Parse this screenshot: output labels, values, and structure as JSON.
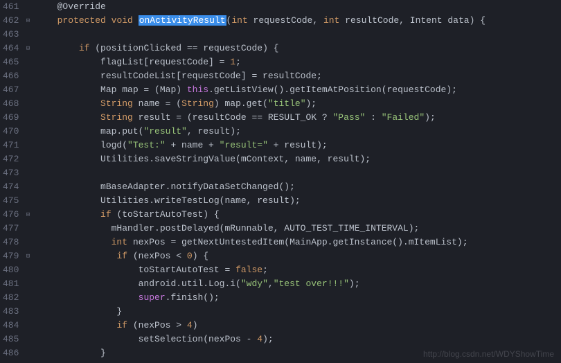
{
  "gutter": {
    "start": 461,
    "end": 486
  },
  "fold_markers": {
    "462": "⊟",
    "464": "⊟",
    "476": "⊟",
    "479": "⊟"
  },
  "code": {
    "l461": {
      "indent": "    ",
      "t": [
        {
          "c": "ann",
          "v": "@Override"
        }
      ]
    },
    "l462": {
      "indent": "    ",
      "t": [
        {
          "c": "kw",
          "v": "protected"
        },
        {
          "c": "",
          "v": " "
        },
        {
          "c": "kw",
          "v": "void"
        },
        {
          "c": "",
          "v": " "
        },
        {
          "c": "hl",
          "v": "onActivityResult"
        },
        {
          "c": "",
          "v": "("
        },
        {
          "c": "kw",
          "v": "int"
        },
        {
          "c": "",
          "v": " requestCode, "
        },
        {
          "c": "kw",
          "v": "int"
        },
        {
          "c": "",
          "v": " resultCode, Intent data) {"
        }
      ]
    },
    "l463": {
      "indent": "",
      "t": []
    },
    "l464": {
      "indent": "        ",
      "t": [
        {
          "c": "kw",
          "v": "if"
        },
        {
          "c": "",
          "v": " (positionClicked == requestCode) {"
        }
      ]
    },
    "l465": {
      "indent": "            ",
      "t": [
        {
          "c": "",
          "v": "flagList[requestCode] = "
        },
        {
          "c": "num",
          "v": "1"
        },
        {
          "c": "",
          "v": ";"
        }
      ]
    },
    "l466": {
      "indent": "            ",
      "t": [
        {
          "c": "",
          "v": "resultCodeList[requestCode] = resultCode;"
        }
      ]
    },
    "l467": {
      "indent": "            ",
      "t": [
        {
          "c": "",
          "v": "Map map = (Map) "
        },
        {
          "c": "this",
          "v": "this"
        },
        {
          "c": "",
          "v": ".getListView().getItemAtPosition(requestCode);"
        }
      ]
    },
    "l468": {
      "indent": "            ",
      "t": [
        {
          "c": "type",
          "v": "String"
        },
        {
          "c": "",
          "v": " name = ("
        },
        {
          "c": "type",
          "v": "String"
        },
        {
          "c": "",
          "v": ") map.get("
        },
        {
          "c": "str",
          "v": "\"title\""
        },
        {
          "c": "",
          "v": ");"
        }
      ]
    },
    "l469": {
      "indent": "            ",
      "t": [
        {
          "c": "type",
          "v": "String"
        },
        {
          "c": "",
          "v": " result = (resultCode == RESULT_OK ? "
        },
        {
          "c": "str",
          "v": "\"Pass\""
        },
        {
          "c": "",
          "v": " : "
        },
        {
          "c": "str",
          "v": "\"Failed\""
        },
        {
          "c": "",
          "v": ");"
        }
      ]
    },
    "l470": {
      "indent": "            ",
      "t": [
        {
          "c": "",
          "v": "map.put("
        },
        {
          "c": "str",
          "v": "\"result\""
        },
        {
          "c": "",
          "v": ", result);"
        }
      ]
    },
    "l471": {
      "indent": "            ",
      "t": [
        {
          "c": "",
          "v": "logd("
        },
        {
          "c": "str",
          "v": "\"Test:\""
        },
        {
          "c": "",
          "v": " + name + "
        },
        {
          "c": "str",
          "v": "\"result=\""
        },
        {
          "c": "",
          "v": " + result);"
        }
      ]
    },
    "l472": {
      "indent": "            ",
      "t": [
        {
          "c": "",
          "v": "Utilities.saveStringValue(mContext, name, result);"
        }
      ]
    },
    "l473": {
      "indent": "",
      "t": []
    },
    "l474": {
      "indent": "            ",
      "t": [
        {
          "c": "",
          "v": "mBaseAdapter.notifyDataSetChanged();"
        }
      ]
    },
    "l475": {
      "indent": "            ",
      "t": [
        {
          "c": "",
          "v": "Utilities.writeTestLog(name, result);"
        }
      ]
    },
    "l476": {
      "indent": "            ",
      "t": [
        {
          "c": "kw",
          "v": "if"
        },
        {
          "c": "",
          "v": " (toStartAutoTest) {"
        }
      ]
    },
    "l477": {
      "indent": "              ",
      "t": [
        {
          "c": "",
          "v": "mHandler.postDelayed(mRunnable, AUTO_TEST_TIME_INTERVAL);"
        }
      ]
    },
    "l478": {
      "indent": "              ",
      "t": [
        {
          "c": "kw",
          "v": "int"
        },
        {
          "c": "",
          "v": " nexPos = getNextUntestedItem(MainApp.getInstance().mItemList);"
        }
      ]
    },
    "l479": {
      "indent": "               ",
      "t": [
        {
          "c": "kw",
          "v": "if"
        },
        {
          "c": "",
          "v": " (nexPos < "
        },
        {
          "c": "num",
          "v": "0"
        },
        {
          "c": "",
          "v": ") {"
        }
      ]
    },
    "l480": {
      "indent": "                   ",
      "t": [
        {
          "c": "",
          "v": "toStartAutoTest = "
        },
        {
          "c": "bool",
          "v": "false"
        },
        {
          "c": "",
          "v": ";"
        }
      ]
    },
    "l481": {
      "indent": "                   ",
      "t": [
        {
          "c": "",
          "v": "android.util.Log.i("
        },
        {
          "c": "str",
          "v": "\"wdy\""
        },
        {
          "c": "",
          "v": ","
        },
        {
          "c": "str",
          "v": "\"test over!!!\""
        },
        {
          "c": "",
          "v": ");"
        }
      ]
    },
    "l482": {
      "indent": "                   ",
      "t": [
        {
          "c": "this",
          "v": "super"
        },
        {
          "c": "",
          "v": ".finish();"
        }
      ]
    },
    "l483": {
      "indent": "               ",
      "t": [
        {
          "c": "",
          "v": "}"
        }
      ]
    },
    "l484": {
      "indent": "               ",
      "t": [
        {
          "c": "kw",
          "v": "if"
        },
        {
          "c": "",
          "v": " (nexPos > "
        },
        {
          "c": "num",
          "v": "4"
        },
        {
          "c": "",
          "v": ")"
        }
      ]
    },
    "l485": {
      "indent": "                   ",
      "t": [
        {
          "c": "",
          "v": "setSelection(nexPos - "
        },
        {
          "c": "num",
          "v": "4"
        },
        {
          "c": "",
          "v": ");"
        }
      ]
    },
    "l486": {
      "indent": "            ",
      "t": [
        {
          "c": "",
          "v": "}"
        }
      ]
    }
  },
  "watermark": "http://blog.csdn.net/WDYShowTime"
}
